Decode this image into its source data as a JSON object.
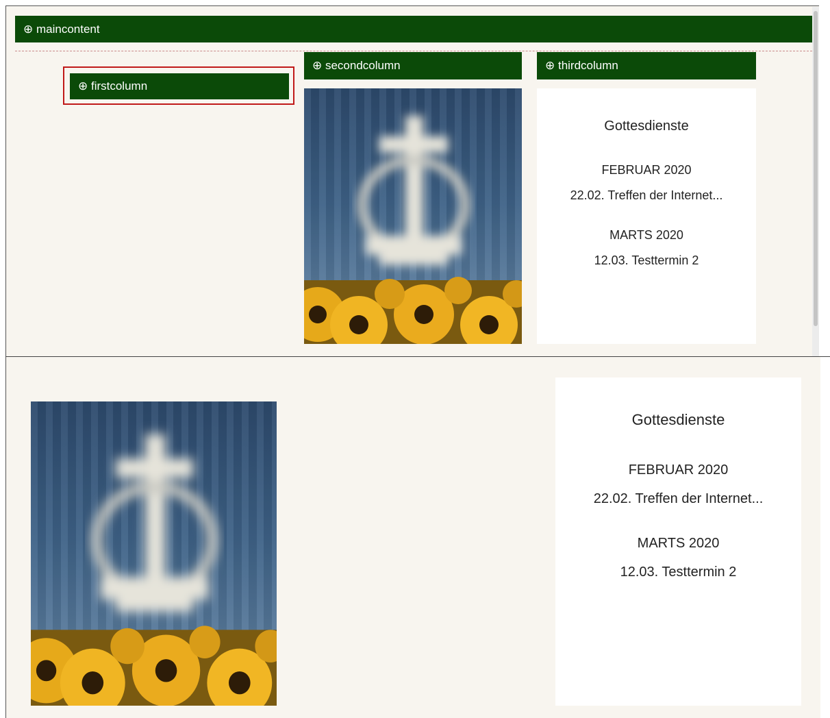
{
  "colors": {
    "bar_green": "#0b4a08",
    "selection_red": "#c01919",
    "page_bg": "#f8f5ef"
  },
  "bars": {
    "maincontent": {
      "icon": "plus-circle-icon",
      "label": "⊕ maincontent"
    },
    "firstcolumn": {
      "icon": "plus-circle-icon",
      "label": "⊕ firstcolumn"
    },
    "secondcolumn": {
      "icon": "plus-circle-icon",
      "label": "⊕ secondcolumn"
    },
    "thirdcolumn": {
      "icon": "plus-circle-icon",
      "label": "⊕ thirdcolumn"
    }
  },
  "images": {
    "church": {
      "icon": "cross-emblem-sunflowers-photo"
    }
  },
  "events_card": {
    "title": "Gottesdienste",
    "lines": [
      "FEBRUAR 2020",
      "22.02. Treffen der Internet...",
      "MARTS 2020",
      "12.03. Testtermin 2"
    ]
  }
}
